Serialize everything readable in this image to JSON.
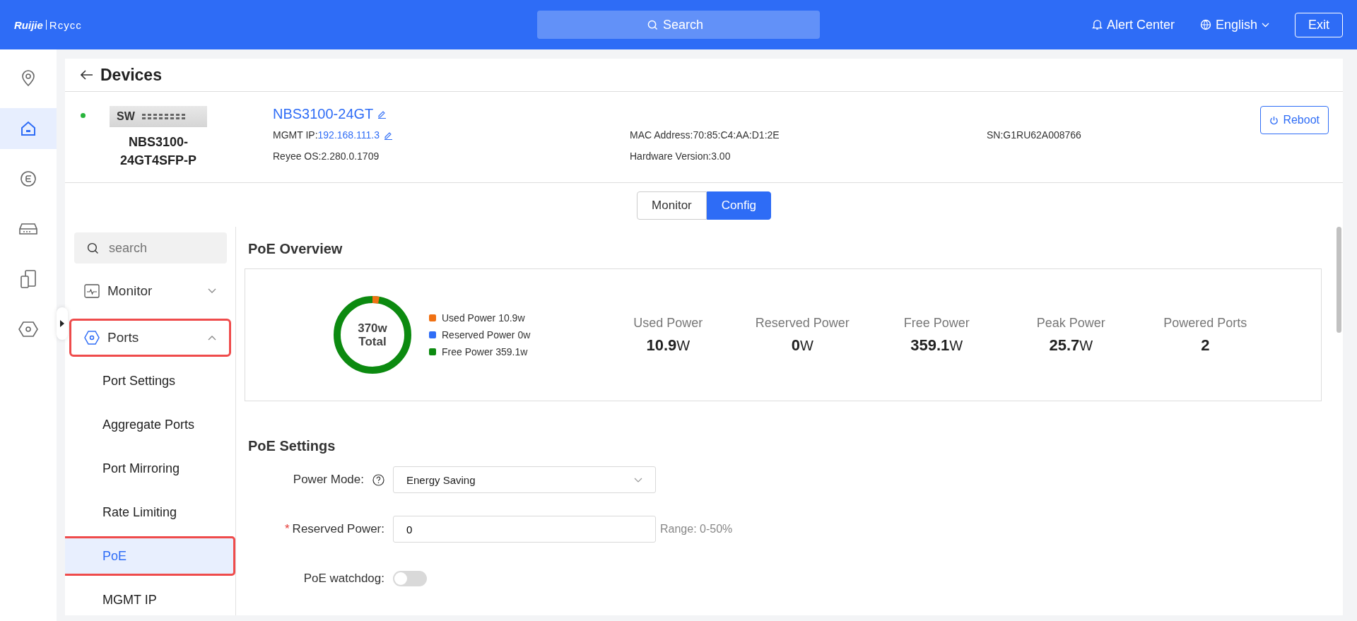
{
  "top_bar": {
    "logo": {
      "brand": "Ruijie",
      "product": "Rcycc"
    },
    "search": {
      "placeholder": "Search"
    },
    "alert_center": "Alert Center",
    "language": "English",
    "exit": "Exit"
  },
  "rail": [
    {
      "selected": false
    },
    {
      "selected": true
    },
    {
      "selected": false
    },
    {
      "selected": false
    },
    {
      "selected": false
    },
    {
      "selected": false
    }
  ],
  "page": {
    "title": "Devices"
  },
  "device": {
    "online": true,
    "badge": "SW",
    "model": "NBS3100-24GT4SFP-P",
    "name": "NBS3100-24GT",
    "info": [
      {
        "kind": "link",
        "label": "MGMT IP:",
        "value": "192.168.111.3"
      },
      {
        "kind": "text",
        "label": "MAC Address: ",
        "value": "70:85:C4:AA:D1:2E"
      },
      {
        "kind": "text",
        "label": "SN:",
        "value": "G1RU62A008766"
      },
      {
        "kind": "text",
        "label": "Reyee OS:",
        "value": "2.280.0.1709"
      },
      {
        "kind": "text",
        "label": "Hardware Version: ",
        "value": "3.00"
      }
    ],
    "reboot": "Reboot"
  },
  "tabs": [
    {
      "label": "Monitor",
      "selected": false
    },
    {
      "label": "Config",
      "selected": true
    }
  ],
  "nav": {
    "search": {
      "placeholder": "search"
    },
    "items": [
      {
        "label": "Monitor",
        "expanded": false,
        "highlighted": false
      },
      {
        "label": "Ports",
        "expanded": true,
        "highlighted": true,
        "children": [
          {
            "label": "Port Settings",
            "selected": false,
            "highlighted": false
          },
          {
            "label": "Aggregate Ports",
            "selected": false,
            "highlighted": false
          },
          {
            "label": "Port Mirroring",
            "selected": false,
            "highlighted": false
          },
          {
            "label": "Rate Limiting",
            "selected": false,
            "highlighted": false
          },
          {
            "label": "PoE",
            "selected": true,
            "highlighted": true
          },
          {
            "label": "MGMT IP",
            "selected": false,
            "highlighted": false
          }
        ]
      }
    ]
  },
  "overview": {
    "title": "PoE Overview",
    "total": "370w",
    "total_label": "Total",
    "legend": [
      {
        "label": "Used Power 10.9w",
        "color": "#f07113"
      },
      {
        "label": "Reserved Power 0w",
        "color": "#2f6df6"
      },
      {
        "label": "Free Power 359.1w",
        "color": "#0c8a10"
      }
    ],
    "stats": [
      {
        "label": "Used Power",
        "value": "10.9",
        "unit": "W"
      },
      {
        "label": "Reserved Power",
        "value": "0",
        "unit": "W"
      },
      {
        "label": "Free Power",
        "value": "359.1",
        "unit": "W"
      },
      {
        "label": "Peak Power",
        "value": "25.7",
        "unit": "W"
      },
      {
        "label": "Powered Ports",
        "value": "2"
      }
    ]
  },
  "settings": {
    "title": "PoE Settings",
    "fields": [
      {
        "kind": "select",
        "label": "Power Mode:",
        "help": true,
        "value": "Energy Saving"
      },
      {
        "kind": "input",
        "label": "Reserved Power:",
        "required_mark": "*",
        "value": "0",
        "hint": "Range: 0-50%"
      },
      {
        "kind": "toggle",
        "label": "PoE watchdog:",
        "on": false
      }
    ]
  }
}
